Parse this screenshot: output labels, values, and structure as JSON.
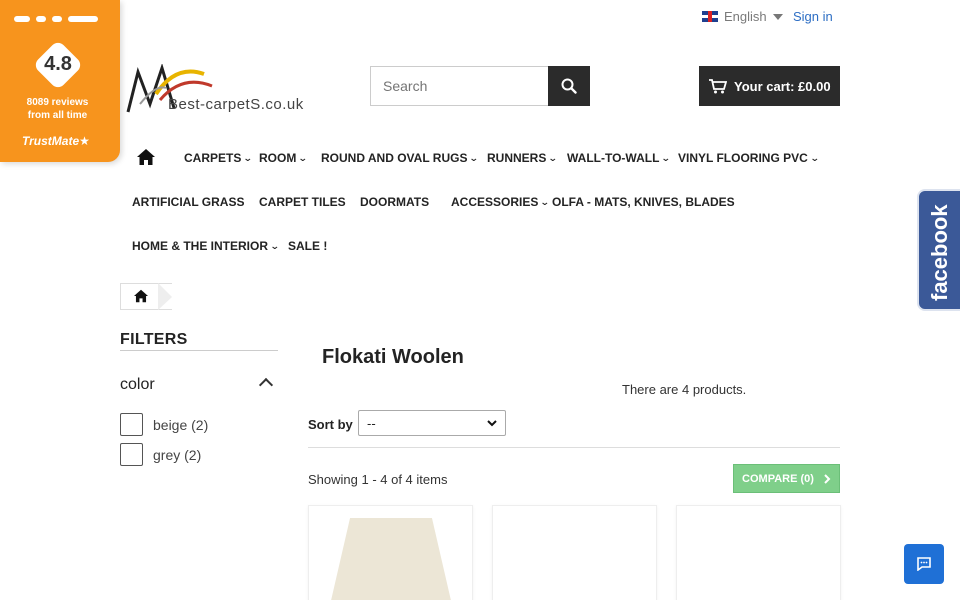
{
  "trustmate": {
    "score": "4.8",
    "reviews_line1": "8089 reviews",
    "reviews_line2": "from all time",
    "brand": "TrustMate"
  },
  "topbar": {
    "language": "English",
    "signin": "Sign in"
  },
  "logo": {
    "text": "Best-carpetS.co.uk"
  },
  "search": {
    "placeholder": "Search"
  },
  "cart": {
    "label": "Your cart: £0.00"
  },
  "menu": {
    "items": [
      {
        "label": "CARPETS"
      },
      {
        "label": "ROOM"
      },
      {
        "label": "ROUND AND OVAL RUGS"
      },
      {
        "label": "RUNNERS"
      },
      {
        "label": "WALL-TO-WALL"
      },
      {
        "label": "VINYL FLOORING PVC"
      },
      {
        "label": "ARTIFICIAL GRASS"
      },
      {
        "label": "CARPET TILES"
      },
      {
        "label": "DOORMATS"
      },
      {
        "label": "ACCESSORIES"
      },
      {
        "label": "OLFA - MATS, KNIVES, BLADES"
      },
      {
        "label": "HOME & THE INTERIOR"
      },
      {
        "label": "SALE !"
      }
    ]
  },
  "facebook": {
    "label": "facebook"
  },
  "filters": {
    "title": "FILTERS",
    "facet": "color",
    "options": [
      {
        "label": "beige (2)"
      },
      {
        "label": "grey (2)"
      }
    ]
  },
  "main": {
    "title": "Flokati Woolen",
    "product_count": "There are 4 products.",
    "sort_label": "Sort by",
    "sort_value": "--",
    "showing": "Showing 1 - 4 of 4 items",
    "compare": "COMPARE (0)"
  },
  "colors": {
    "trustmate_orange": "#f7941d",
    "facebook_blue": "#3b5998",
    "compare_green": "#7fcf8a",
    "chat_blue": "#1f70d6"
  }
}
